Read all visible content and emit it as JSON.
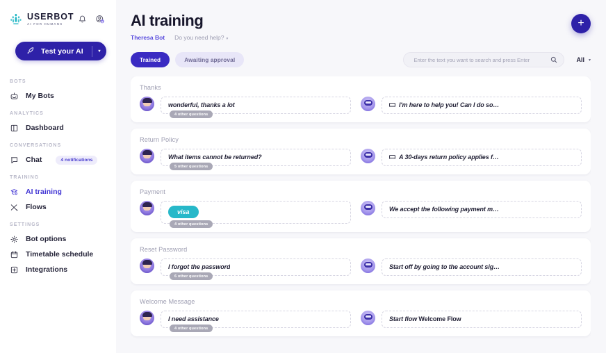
{
  "sidebar": {
    "brand": {
      "name": "USERBOT",
      "tagline": "AI FOR HUMANS"
    },
    "header_icons": [
      {
        "name": "bell-icon"
      },
      {
        "name": "help-avatar-icon"
      }
    ],
    "test_button": {
      "label": "Test your AI",
      "icon": "rocket-icon",
      "caret": "▾"
    },
    "sections": [
      {
        "label": "BOTS",
        "items": [
          {
            "label": "My Bots",
            "icon": "robot-icon",
            "active": false,
            "badge": ""
          }
        ]
      },
      {
        "label": "ANALYTICS",
        "items": [
          {
            "label": "Dashboard",
            "icon": "dashboard-icon",
            "active": false,
            "badge": ""
          }
        ]
      },
      {
        "label": "CONVERSATIONS",
        "items": [
          {
            "label": "Chat",
            "icon": "chat-bubble-icon",
            "active": false,
            "badge": "4 notifications"
          }
        ]
      },
      {
        "label": "TRAINING",
        "items": [
          {
            "label": "AI training",
            "icon": "graduation-icon",
            "active": true,
            "badge": ""
          },
          {
            "label": "Flows",
            "icon": "flows-icon",
            "active": false,
            "badge": ""
          }
        ]
      },
      {
        "label": "SETTINGS",
        "items": [
          {
            "label": "Bot options",
            "icon": "gear-icon",
            "active": false,
            "badge": ""
          },
          {
            "label": "Timetable schedule",
            "icon": "calendar-icon",
            "active": false,
            "badge": ""
          },
          {
            "label": "Integrations",
            "icon": "puzzle-plus-icon",
            "active": false,
            "badge": ""
          }
        ]
      }
    ]
  },
  "header": {
    "title": "AI training",
    "breadcrumb_bot": "Theresa Bot",
    "breadcrumb_help": "Do you need help?",
    "breadcrumb_caret": "▾",
    "add_button": {
      "label": "+",
      "icon": "plus-icon"
    }
  },
  "toolbar": {
    "tab_trained": "Trained",
    "tab_awaiting": "Awaiting approval",
    "search_placeholder": "Enter the text you want to search and press Enter",
    "search_value": "",
    "search_icon": "search-icon",
    "filter_label": "All",
    "filter_caret": "▾"
  },
  "colors": {
    "brand_purple": "#2e21a8",
    "accent_purple": "#4236d4",
    "tab_active": "#3a2bc2",
    "tab_inactive_bg": "#e8e6f8",
    "visa_teal": "#27b8c9",
    "badge_grey": "#a9a8b6",
    "page_bg": "#f7f7fa"
  },
  "cards": [
    {
      "title": "Thanks",
      "user": {
        "avatar": "user-avatar",
        "text": "wonderful, thanks a lot",
        "style": "italic",
        "other_questions": "4 other questions",
        "is_visa_pill": false
      },
      "bot": {
        "avatar": "bot-avatar",
        "icon": "keyboard-icon",
        "text": "I'm here to help you! Can I do so…",
        "prefix": "",
        "suffix": ""
      }
    },
    {
      "title": "Return Policy",
      "user": {
        "avatar": "user-avatar",
        "text": "What items cannot be returned?",
        "style": "italic",
        "other_questions": "5 other questions",
        "is_visa_pill": false
      },
      "bot": {
        "avatar": "bot-avatar",
        "icon": "keyboard-icon",
        "text": "A 30-days return policy applies f…",
        "prefix": "",
        "suffix": ""
      }
    },
    {
      "title": "Payment",
      "user": {
        "avatar": "user-avatar",
        "text": "visa",
        "style": "italic",
        "other_questions": "4 other questions",
        "is_visa_pill": true
      },
      "bot": {
        "avatar": "bot-avatar",
        "icon": "",
        "text": "We accept the following payment m…",
        "prefix": "",
        "suffix": ""
      }
    },
    {
      "title": "Reset Password",
      "user": {
        "avatar": "user-avatar",
        "text": "I forgot the password",
        "style": "italic",
        "other_questions": "6 other questions",
        "is_visa_pill": false
      },
      "bot": {
        "avatar": "bot-avatar",
        "icon": "",
        "text": "Start off by going to the account sig…",
        "prefix": "",
        "suffix": ""
      }
    },
    {
      "title": "Welcome Message",
      "user": {
        "avatar": "user-avatar",
        "text": "I need assistance",
        "style": "italic",
        "other_questions": "4 other questions",
        "is_visa_pill": false
      },
      "bot": {
        "avatar": "bot-avatar",
        "icon": "",
        "text": "",
        "prefix": "Start flow",
        "suffix": " Welcome Flow"
      }
    }
  ]
}
